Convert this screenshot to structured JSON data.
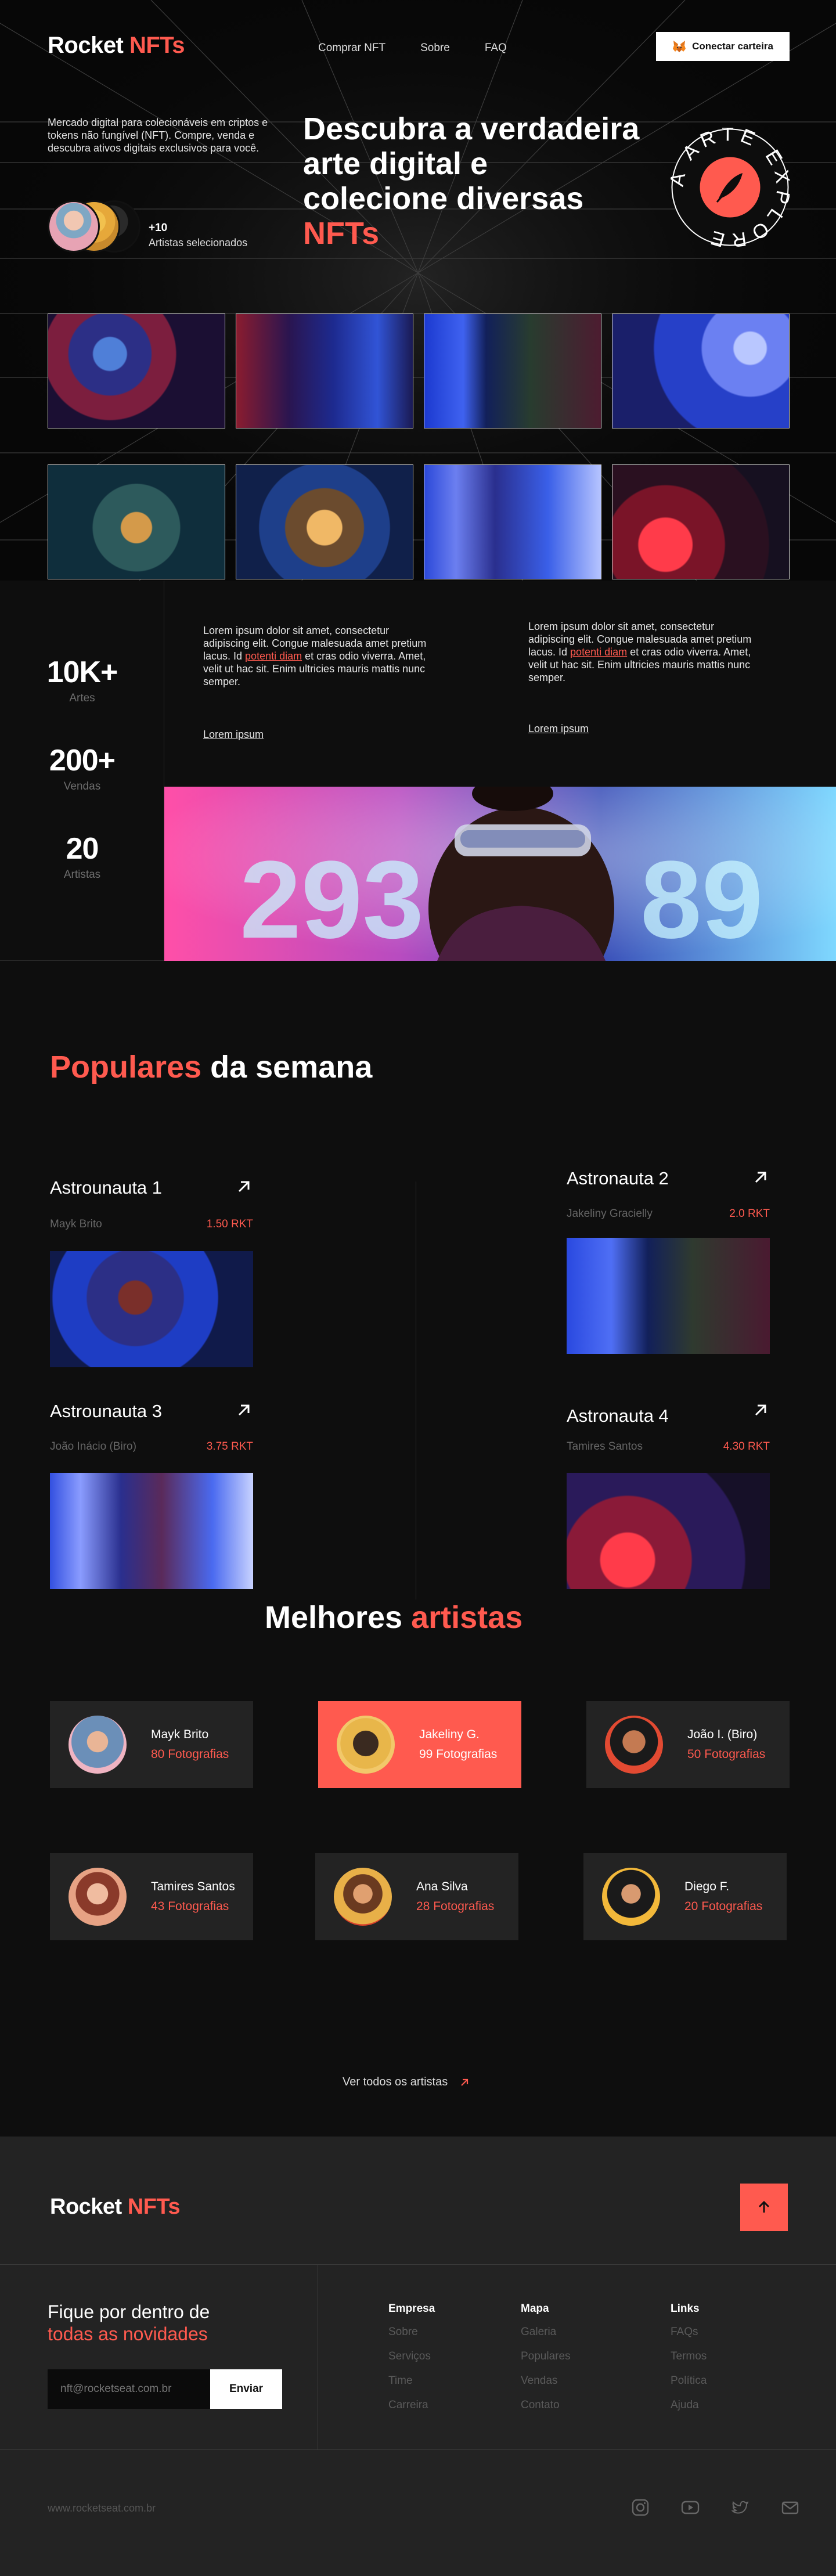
{
  "brand": {
    "name": "Rocket",
    "accent": "NFTs",
    "accent_color": "#ff5a4f"
  },
  "nav": {
    "links": [
      "Comprar NFT",
      "Sobre",
      "FAQ"
    ],
    "connect_label": "Conectar carteira",
    "connect_icon": "metamask-fox-icon"
  },
  "hero": {
    "description": "Mercado digital para colecionáveis em criptos e tokens não fungível (NFT). Compre, venda e descubra ativos digitais exclusivos para você.",
    "title_lines": [
      "Descubra a verdadeira",
      "arte digital e",
      "colecione diversas"
    ],
    "title_accent": "NFTs",
    "artists_count": "+10",
    "artists_label": "Artistas selecionados",
    "badge_text": "A ARTE  EXPLORE",
    "badge_icon": "quill-feather-icon"
  },
  "stats": {
    "items": [
      {
        "value": "10K+",
        "label": "Artes"
      },
      {
        "value": "200+",
        "label": "Vendas"
      },
      {
        "value": "20",
        "label": "Artistas"
      }
    ],
    "blocks": [
      {
        "pre": "Lorem ipsum dolor sit amet, consectetur adipiscing elit. Congue malesuada amet pretium lacus. Id ",
        "link": "potenti diam",
        "post": " et cras odio viverra. Amet, velit ut hac sit. Enim ultricies mauris mattis nunc semper.",
        "cta": "Lorem ipsum"
      },
      {
        "pre": "Lorem ipsum dolor sit amet, consectetur adipiscing elit. Congue malesuada amet pretium lacus. Id ",
        "link": "potenti diam",
        "post": " et cras odio viverra. Amet, velit ut hac sit. Enim ultricies mauris mattis nunc semper.",
        "cta": "Lorem ipsum"
      }
    ]
  },
  "populares": {
    "title_accent": "Populares",
    "title_rest": " da semana",
    "cards": [
      {
        "name": "Astrounauta 1",
        "owner": "Mayk Brito",
        "price": "1.50 RKT"
      },
      {
        "name": "Astronauta 2",
        "owner": "Jakeliny Gracielly",
        "price": "2.0 RKT"
      },
      {
        "name": "Astrounauta 3",
        "owner": "João Inácio (Biro)",
        "price": "3.75 RKT"
      },
      {
        "name": "Astronauta 4",
        "owner": "Tamires Santos",
        "price": "4.30 RKT"
      }
    ]
  },
  "artistas": {
    "title_rest": "Melhores ",
    "title_accent": "artistas",
    "items": [
      {
        "name": "Mayk Brito",
        "count": "80 Fotografias"
      },
      {
        "name": "Jakeliny G.",
        "count": "99 Fotografias"
      },
      {
        "name": "João I. (Biro)",
        "count": "50 Fotografias"
      },
      {
        "name": "Tamires Santos",
        "count": "43 Fotografias"
      },
      {
        "name": "Ana Silva",
        "count": "28 Fotografias"
      },
      {
        "name": "Diego F.",
        "count": "20 Fotografias"
      }
    ],
    "see_all": "Ver todos os artistas"
  },
  "footer": {
    "newsletter_line1": "Fique por dentro de",
    "newsletter_line2": "todas as novidades",
    "email_placeholder": "nft@rocketseat.com.br",
    "send_label": "Enviar",
    "columns": [
      {
        "title": "Empresa",
        "links": [
          "Sobre",
          "Serviços",
          "Time",
          "Carreira"
        ]
      },
      {
        "title": "Mapa",
        "links": [
          "Galeria",
          "Populares",
          "Vendas",
          "Contato"
        ]
      },
      {
        "title": "Links",
        "links": [
          "FAQs",
          "Termos",
          "Política",
          "Ajuda"
        ]
      }
    ],
    "copyright": "www.rocketseat.com.br",
    "social_icons": [
      "instagram-icon",
      "youtube-icon",
      "twitter-icon",
      "mail-icon"
    ]
  }
}
